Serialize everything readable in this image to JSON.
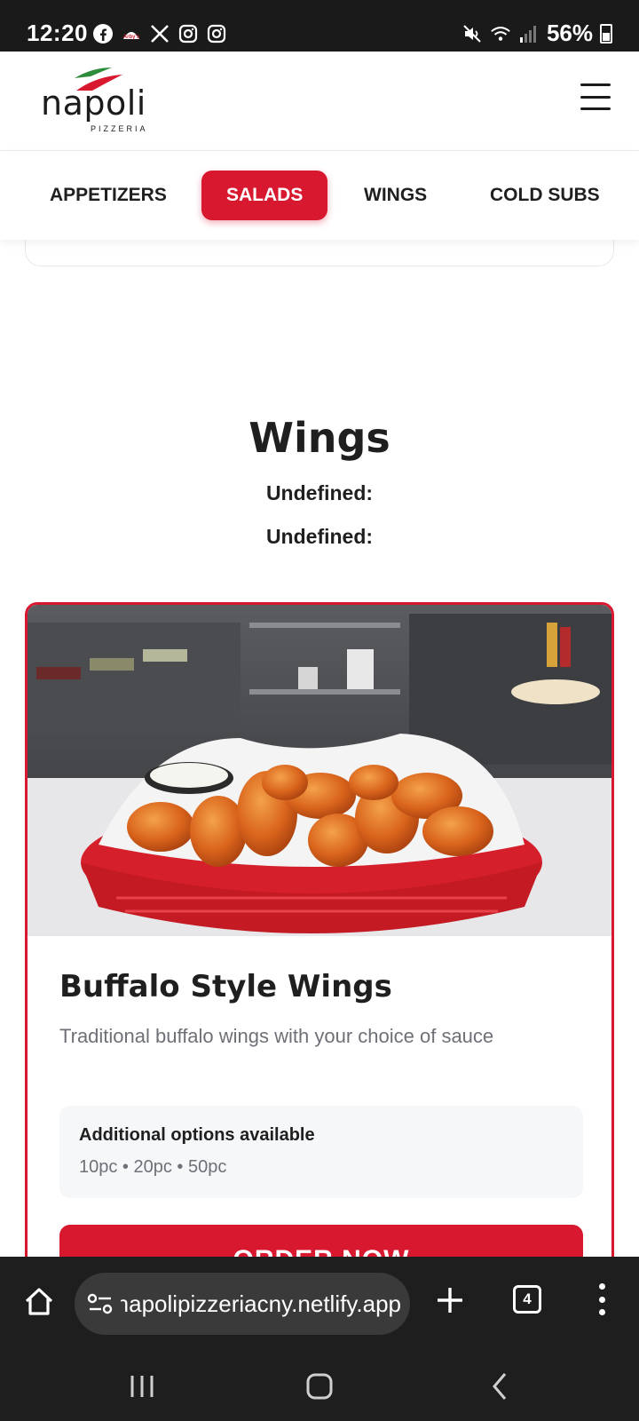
{
  "status_bar": {
    "time": "12:20",
    "left_icons": [
      "facebook-icon",
      "arbys-icon",
      "x-icon",
      "instagram-icon",
      "instagram-icon"
    ],
    "battery": "56%"
  },
  "header": {
    "logo_text": "napoli",
    "logo_subtitle": "PIZZERIA"
  },
  "categories": {
    "tabs": [
      {
        "label": "APPETIZERS",
        "active": false
      },
      {
        "label": "SALADS",
        "active": true
      },
      {
        "label": "WINGS",
        "active": false
      },
      {
        "label": "COLD SUBS",
        "active": false
      }
    ]
  },
  "section": {
    "title": "Wings",
    "lines": [
      "Undefined:",
      "Undefined:"
    ]
  },
  "item": {
    "name": "Buffalo Style Wings",
    "description": "Traditional buffalo wings with your choice of sauce",
    "options_title": "Additional options available",
    "options_list": "10pc • 20pc • 50pc",
    "order_label": "ORDER NOW"
  },
  "browser": {
    "url": "napolipizzeriacny.netlify.app",
    "tab_count": "4"
  },
  "colors": {
    "accent": "#d8182f",
    "muted_text": "#6e7077"
  }
}
